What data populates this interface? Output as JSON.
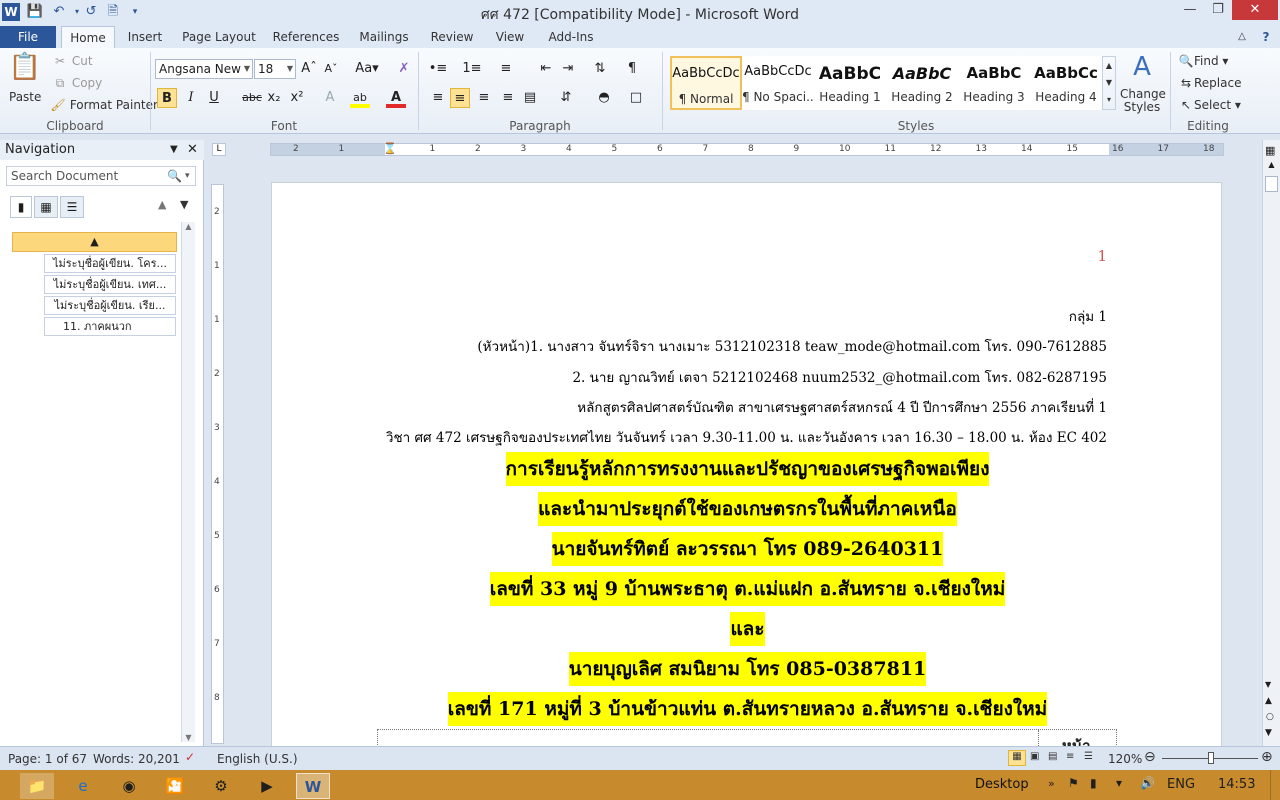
{
  "window": {
    "title": "ศศ 472 [Compatibility Mode]  -  Microsoft Word",
    "app_icon": "W"
  },
  "tabs": [
    "File",
    "Home",
    "Insert",
    "Page Layout",
    "References",
    "Mailings",
    "Review",
    "View",
    "Add-Ins"
  ],
  "ribbon": {
    "clipboard": {
      "paste": "Paste",
      "cut": "Cut",
      "copy": "Copy",
      "format_painter": "Format Painter",
      "label": "Clipboard"
    },
    "font": {
      "name": "Angsana New",
      "size": "18",
      "label": "Font"
    },
    "paragraph": {
      "label": "Paragraph"
    },
    "styles": {
      "label": "Styles",
      "items": [
        {
          "sample": "AaBbCcDc",
          "name": "¶ Normal"
        },
        {
          "sample": "AaBbCcDc",
          "name": "¶ No Spaci..."
        },
        {
          "sample": "AaBbC",
          "name": "Heading 1"
        },
        {
          "sample": "AaBbC",
          "name": "Heading 2"
        },
        {
          "sample": "AaBbC",
          "name": "Heading 3"
        },
        {
          "sample": "AaBbCc",
          "name": "Heading 4"
        }
      ],
      "change_styles": "Change Styles"
    },
    "editing": {
      "find": "Find",
      "replace": "Replace",
      "select": "Select",
      "label": "Editing"
    }
  },
  "navigation": {
    "title": "Navigation",
    "search_placeholder": "Search Document",
    "items": [
      "ไม่ระบุชื่อผู้เขียน. โคร...",
      "ไม่ระบุชื่อผู้เขียน. เทศ...",
      "ไม่ระบุชื่อผู้เขียน. เรีย...",
      "11. ภาคผนวก"
    ]
  },
  "document": {
    "page_number": "1",
    "lines": [
      "กลุ่ม 1",
      "(หัวหน้า)1. นางสาว จันทร์จิรา นางเมาะ 5312102318  teaw_mode@hotmail.com  โทร. 090-7612885",
      "2. นาย ญาณวิทย์ เตจา 5212102468  nuum2532_@hotmail.com  โทร. 082-6287195",
      "หลักสูตรศิลปศาสตร์บัณฑิต สาขาเศรษฐศาสตร์สหกรณ์ 4 ปี ปีการศึกษา 2556 ภาคเรียนที่ 1",
      "วิชา ศศ 472 เศรษฐกิจของประเทศไทย วันจันทร์ เวลา 9.30-11.00 น. และวันอังคาร เวลา 16.30 – 18.00 น. ห้อง EC 402"
    ],
    "highlighted": [
      "การเรียนรู้หลักการทรงงานและปรัชญาของเศรษฐกิจพอเพียง",
      "และนำมาประยุกต์ใช้ของเกษตรกรในพื้นที่ภาคเหนือ",
      "นายจันทร์ทิตย์ ละวรรณา โทร 089-2640311",
      "เลขที่ 33 หมู่ 9 บ้านพระธาตุ ต.แม่แฝก อ.สันทราย จ.เชียงใหม่",
      "และ",
      "นายบุญเลิศ สมนิยาม โทร 085-0387811",
      "เลขที่ 171 หมู่ที่ 3 บ้านข้าวแท่น ต.สันทรายหลวง อ.สันทราย จ.เชียงใหม่"
    ],
    "table_header": "หน้า"
  },
  "status": {
    "page": "Page: 1 of 67",
    "words": "Words: 20,201",
    "language": "English (U.S.)",
    "zoom": "120%"
  },
  "taskbar": {
    "desktop": "Desktop",
    "lang": "ENG",
    "time": "14:53"
  },
  "colors": {
    "accent": "#2b579a",
    "highlight": "#ffff00",
    "taskbar": "#c78b2e"
  }
}
